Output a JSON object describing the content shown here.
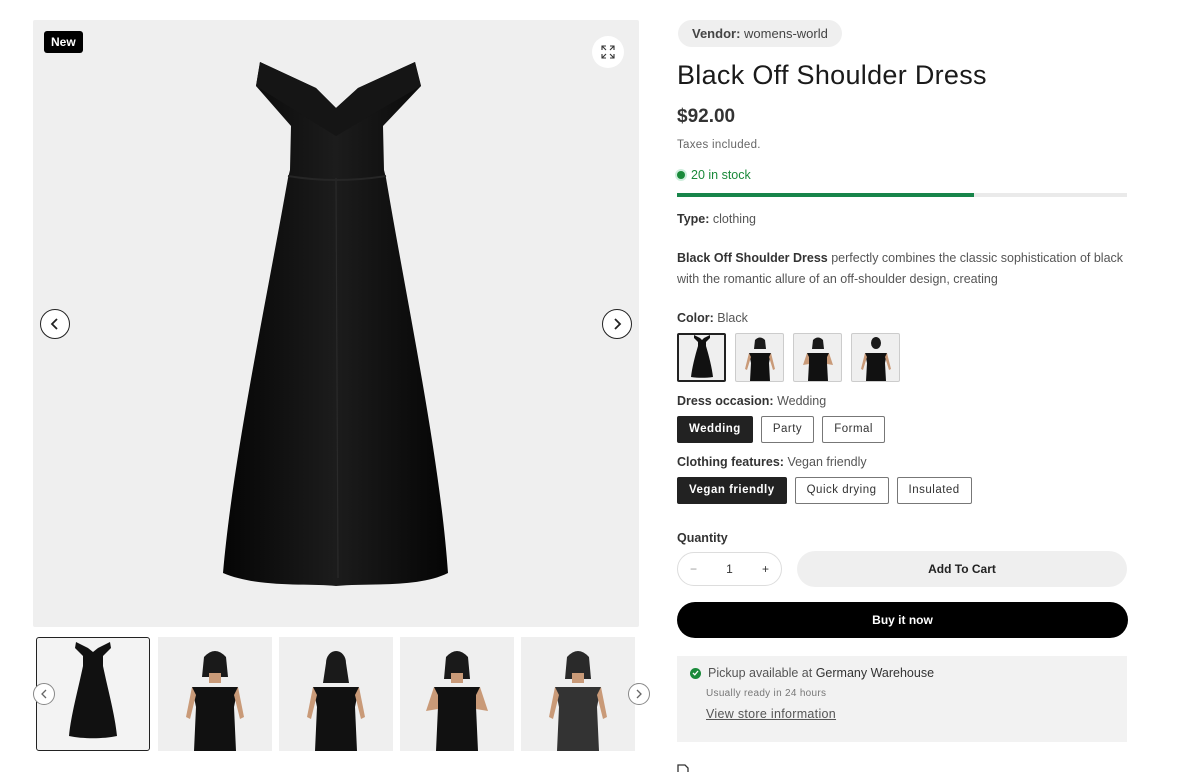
{
  "gallery": {
    "badge": "New",
    "thumbnail_count": 5
  },
  "product": {
    "vendor_label": "Vendor:",
    "vendor": "womens-world",
    "title": "Black Off Shoulder Dress",
    "price": "$92.00",
    "tax_note": "Taxes included.",
    "stock_text": "20 in stock",
    "stock_level": 0.66,
    "type_label": "Type:",
    "type": "clothing",
    "description_bold": "Black Off Shoulder Dress",
    "description_rest": " perfectly combines the classic sophistication of black with the romantic allure of an off-shoulder design, creating"
  },
  "options": {
    "color_label": "Color:",
    "color_value": "Black",
    "occasion_label": "Dress occasion:",
    "occasion_value": "Wedding",
    "occasions": [
      "Wedding",
      "Party",
      "Formal"
    ],
    "features_label": "Clothing features:",
    "features_value": "Vegan friendly",
    "features": [
      "Vegan friendly",
      "Quick drying",
      "Insulated"
    ]
  },
  "purchase": {
    "quantity_label": "Quantity",
    "quantity_value": "1",
    "minus": "−",
    "plus": "+",
    "add_to_cart": "Add To Cart",
    "buy_now": "Buy it now"
  },
  "pickup": {
    "prefix": "Pickup available at ",
    "location": "Germany Warehouse",
    "ready": "Usually ready in 24 hours",
    "link": "View store information"
  },
  "colors": {
    "stock_green": "#1a8a3a",
    "dress_black": "#0d0d0d",
    "skin": "#c99a78"
  }
}
